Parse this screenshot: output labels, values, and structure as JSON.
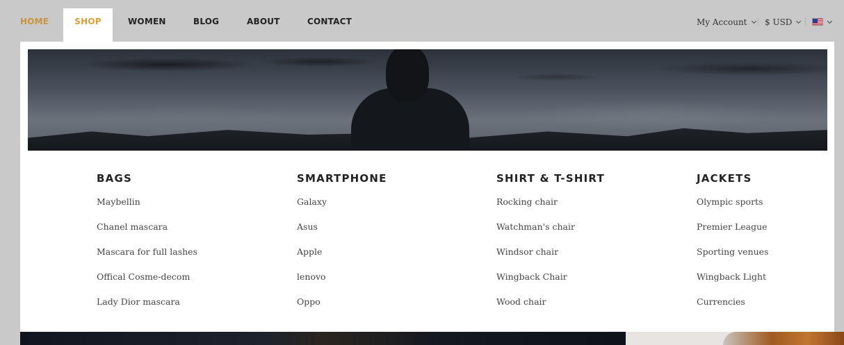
{
  "nav": {
    "items": [
      {
        "label": "HOME",
        "state": "active-color"
      },
      {
        "label": "SHOP",
        "state": "open"
      },
      {
        "label": "WOMEN"
      },
      {
        "label": "BLOG"
      },
      {
        "label": "ABOUT"
      },
      {
        "label": "CONTACT"
      }
    ],
    "account_label": "My Account",
    "currency_label": "$ USD",
    "language_icon": "us-flag-icon"
  },
  "mega_menu": {
    "columns": [
      {
        "title": "BAGS",
        "links": [
          "Maybellin",
          "Chanel mascara",
          "Mascara for full lashes",
          "Offical Cosme-decom",
          "Lady Dior mascara"
        ]
      },
      {
        "title": "SMARTPHONE",
        "links": [
          "Galaxy",
          "Asus",
          "Apple",
          "lenovo",
          "Oppo"
        ]
      },
      {
        "title": "SHIRT & T-SHIRT",
        "links": [
          "Rocking chair",
          "Watchman's chair",
          "Windsor chair",
          "Wingback Chair",
          "Wood chair"
        ]
      },
      {
        "title": "JACKETS",
        "links": [
          "Olympic sports",
          "Premier League",
          "Sporting venues",
          "Wingback Light",
          "Currencies"
        ]
      }
    ]
  },
  "colors": {
    "accent": "#dba139",
    "home": "#c9943d",
    "overlay": "#c9c9c9"
  }
}
